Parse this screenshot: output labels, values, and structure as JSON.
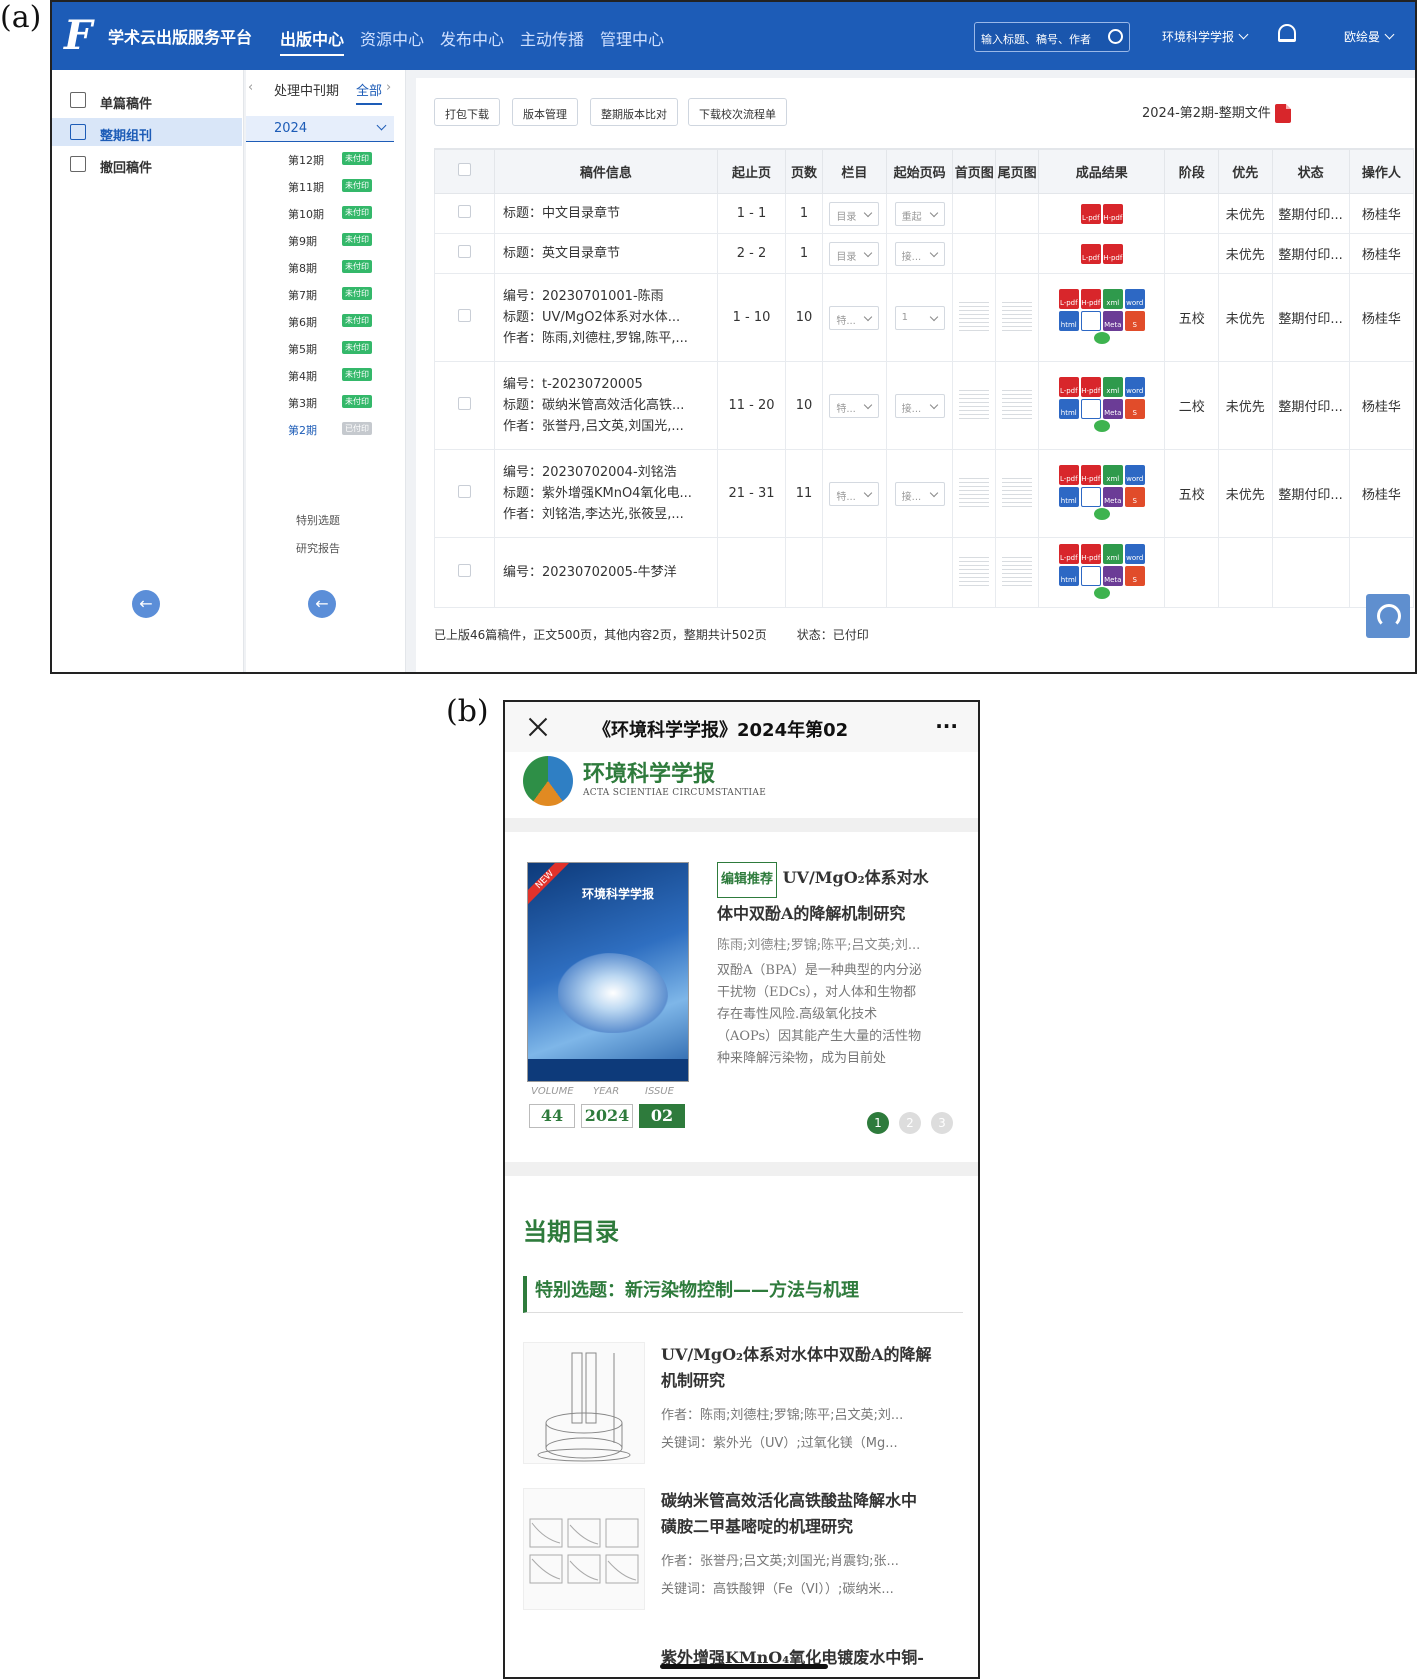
{
  "labels": {
    "a": "(a)",
    "b": "(b)"
  },
  "topbar": {
    "logo": "F",
    "brand": "学术云出版服务平台",
    "nav": [
      "出版中心",
      "资源中心",
      "发布中心",
      "主动传播",
      "管理中心"
    ],
    "search_placeholder": "输入标题、稿号、作者",
    "journal": "环境科学学报",
    "user": "欧绘曼"
  },
  "sidebar": {
    "items": [
      "单篇稿件",
      "整期组刊",
      "撤回稿件"
    ]
  },
  "issues": {
    "tab1": "处理中刊期",
    "tab2": "全部",
    "year": "2024",
    "list": [
      {
        "name": "第12期",
        "tag": "未付印"
      },
      {
        "name": "第11期",
        "tag": "未付印"
      },
      {
        "name": "第10期",
        "tag": "未付印"
      },
      {
        "name": "第9期",
        "tag": "未付印"
      },
      {
        "name": "第8期",
        "tag": "未付印"
      },
      {
        "name": "第7期",
        "tag": "未付印"
      },
      {
        "name": "第6期",
        "tag": "未付印"
      },
      {
        "name": "第5期",
        "tag": "未付印"
      },
      {
        "name": "第4期",
        "tag": "未付印"
      },
      {
        "name": "第3期",
        "tag": "未付印"
      },
      {
        "name": "第2期",
        "tag": "已付印"
      }
    ],
    "sub": [
      "特别选题",
      "研究报告"
    ]
  },
  "toolbar": {
    "buttons": [
      "打包下载",
      "版本管理",
      "整期版本比对",
      "下载校次流程单"
    ],
    "file": "2024-第2期-整期文件"
  },
  "table": {
    "headers": [
      "稿件信息",
      "起止页",
      "页数",
      "栏目",
      "起始页码",
      "首页图",
      "尾页图",
      "成品结果",
      "阶段",
      "优先",
      "状态",
      "操作人"
    ],
    "rows": [
      {
        "info": [
          "标题：中文目录章节"
        ],
        "pages": "1 - 1",
        "count": "1",
        "col": "目录",
        "start": "重起",
        "stage": "",
        "pri": "未优先",
        "status": "整期付印...",
        "op": "杨桂华"
      },
      {
        "info": [
          "标题：英文目录章节"
        ],
        "pages": "2 - 2",
        "count": "1",
        "col": "目录",
        "start": "接...",
        "stage": "",
        "pri": "未优先",
        "status": "整期付印...",
        "op": "杨桂华"
      },
      {
        "info": [
          "编号：20230701001-陈雨",
          "标题：UV/MgO2体系对水体...",
          "作者：陈雨,刘德柱,罗锦,陈平,..."
        ],
        "pages": "1 - 10",
        "count": "10",
        "col": "特...",
        "start": "1",
        "stage": "五校",
        "pri": "未优先",
        "status": "整期付印...",
        "op": "杨桂华"
      },
      {
        "info": [
          "编号：t-20230720005",
          "标题：碳纳米管高效活化高铁...",
          "作者：张誉丹,吕文英,刘国光,..."
        ],
        "pages": "11 - 20",
        "count": "10",
        "col": "特...",
        "start": "接...",
        "stage": "二校",
        "pri": "未优先",
        "status": "整期付印...",
        "op": "杨桂华"
      },
      {
        "info": [
          "编号：20230702004-刘铭浩",
          "标题：紫外增强KMnO4氧化电...",
          "作者：刘铭浩,李达光,张筱昱,..."
        ],
        "pages": "21 - 31",
        "count": "11",
        "col": "特...",
        "start": "接...",
        "stage": "五校",
        "pri": "未优先",
        "status": "整期付印...",
        "op": "杨桂华"
      },
      {
        "info": [
          "编号：20230702005-牛梦洋"
        ],
        "pages": "",
        "count": "",
        "col": "",
        "start": "",
        "stage": "",
        "pri": "",
        "status": "",
        "op": ""
      }
    ],
    "icons": {
      "lpdf": "L-pdf",
      "hpdf": "H-pdf",
      "xml": "xml",
      "word": "word",
      "html": "html",
      "meta": "Meta",
      "s": "S"
    }
  },
  "footer": {
    "summary": "已上版46篇稿件，正文500页，其他内容2页，整期共计502页",
    "status": "状态：已付印"
  },
  "mobile": {
    "title": "《环境科学学报》2024年第02",
    "journal": "环境科学学报",
    "journal_en": "ACTA SCIENTIAE CIRCUMSTANTIAE",
    "cover": {
      "badge": "NEW",
      "title": "环境科学学报"
    },
    "vol_labels": [
      "VOLUME",
      "YEAR",
      "ISSUE"
    ],
    "vol": "44",
    "year": "2024",
    "issue": "02",
    "featured": {
      "tag": "编辑推荐",
      "title1": "UV/MgO₂体系对水",
      "title2": "体中双酚A的降解机制研究",
      "authors": "陈雨;刘德柱;罗锦;陈平;吕文英;刘...",
      "abstract": [
        "双酚A（BPA）是一种典型的内分泌",
        "干扰物（EDCs），对人体和生物都",
        "存在毒性风险.高级氧化技术",
        "（AOPs）因其能产生大量的活性物",
        "种来降解污染物，成为目前处"
      ]
    },
    "pager": [
      "1",
      "2",
      "3"
    ],
    "toc_title": "当期目录",
    "section": "特别选题：新污染物控制——方法与机理",
    "articles": [
      {
        "title": [
          "UV/MgO₂体系对水体中双酚A的降解",
          "机制研究"
        ],
        "authors": "作者：陈雨;刘德柱;罗锦;陈平;吕文英;刘...",
        "keywords": "关键词：紫外光（UV）;过氧化镁（Mg..."
      },
      {
        "title": [
          "碳纳米管高效活化高铁酸盐降解水中",
          "磺胺二甲基嘧啶的机理研究"
        ],
        "authors": "作者：张誉丹;吕文英;刘国光;肖震钧;张...",
        "keywords": "关键词：高铁酸钾（Fe（VI））;碳纳米..."
      }
    ],
    "partial": "紫外增强KMnO₄氧化电镀废水中铜-"
  }
}
